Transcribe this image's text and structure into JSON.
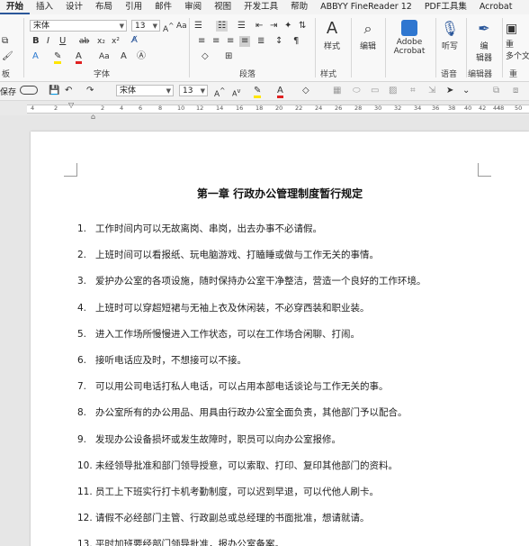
{
  "ribbon_tabs": [
    "开始",
    "插入",
    "设计",
    "布局",
    "引用",
    "邮件",
    "审阅",
    "视图",
    "开发工具",
    "帮助",
    "ABBYY FineReader 12",
    "PDF工具集",
    "Acrobat"
  ],
  "font": {
    "name": "宋体",
    "size": "13"
  },
  "groups": {
    "clipboard_fragment": "板",
    "font": "字体",
    "paragraph": "段落",
    "styles": "样式",
    "voice": "语音",
    "editor": "编辑器",
    "reuse_fragment": "重"
  },
  "buttons": {
    "styles": "样式",
    "edit": "编辑",
    "adobe_line1": "Adobe",
    "adobe_line2": "Acrobat",
    "dictate": "听写",
    "editor_line1": "编",
    "editor_line2": "辑器",
    "reuse_line1": "重",
    "reuse_line2": "多个文"
  },
  "qat": {
    "save_prefix": "保存",
    "font": "宋体",
    "size": "13"
  },
  "ruler": {
    "labels": [
      "4",
      "2",
      "2",
      "4",
      "6",
      "8",
      "10",
      "12",
      "14",
      "16",
      "18",
      "20",
      "22",
      "24",
      "26",
      "28",
      "30",
      "32",
      "34",
      "36",
      "38",
      "40",
      "42",
      "44",
      "48",
      "50"
    ]
  },
  "document": {
    "title": "第一章  行政办公管理制度暂行规定",
    "items": [
      {
        "num": "1.",
        "text": "工作时间内可以无故离岗、串岗，出去办事不必请假。"
      },
      {
        "num": "2.",
        "text": "上班时间可以看报纸、玩电脑游戏、打瞌睡或做与工作无关的事情。"
      },
      {
        "num": "3.",
        "text": "爱护办公室的各项设施，随时保持办公室干净整洁，营造一个良好的工作环境。"
      },
      {
        "num": "4.",
        "text": "上班时可以穿超短裙与无袖上衣及休闲装，不必穿西装和职业装。"
      },
      {
        "num": "5.",
        "text": "进入工作场所慢慢进入工作状态，可以在工作场合闲聊、打闹。"
      },
      {
        "num": "6.",
        "text": "接听电话应及时，不想接可以不接。"
      },
      {
        "num": "7.",
        "text": "可以用公司电话打私人电话，可以占用本部电话谈论与工作无关的事。"
      },
      {
        "num": "8.",
        "text": "办公室所有的办公用品、用具由行政办公室全面负责，其他部门予以配合。"
      },
      {
        "num": "9.",
        "text": "发现办公设备损坏或发生故障时，职员可以向办公室报修。"
      },
      {
        "num": "10.",
        "text": "未经领导批准和部门领导授意，可以索取、打印、复印其他部门的资料。"
      },
      {
        "num": "11.",
        "text": "员工上下班实行打卡机考勤制度，可以迟到早退，可以代他人刷卡。"
      },
      {
        "num": "12.",
        "text": "请假不必经部门主管、行政副总或总经理的书面批准，想请就请。"
      },
      {
        "num": "13.",
        "text": "平时加班要经部门领导批准，报办公室备案。"
      }
    ]
  }
}
